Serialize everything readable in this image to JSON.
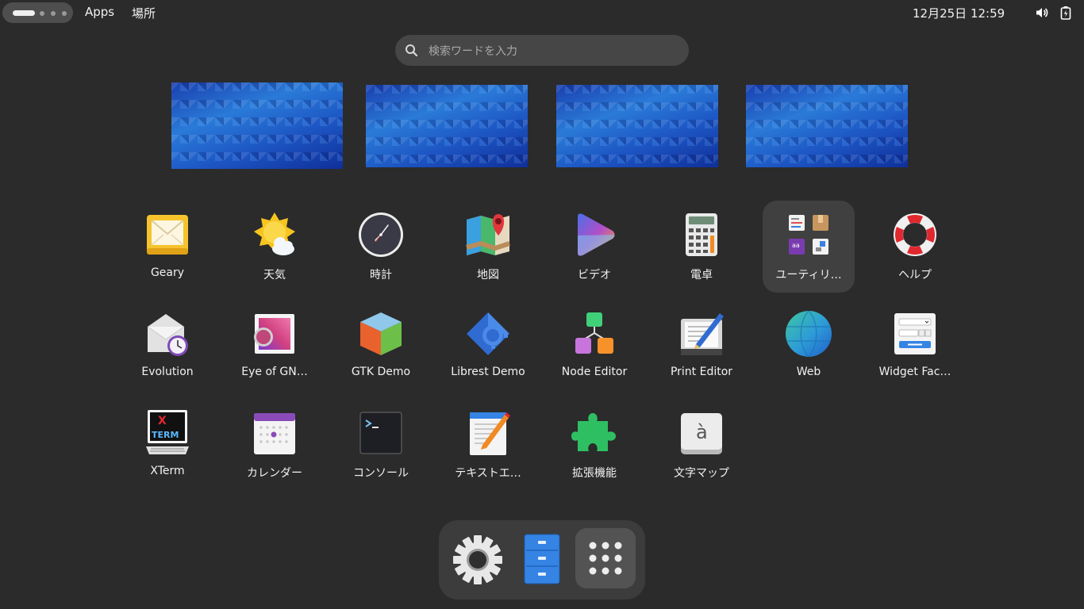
{
  "topbar": {
    "apps_label": "Apps",
    "places_label": "場所",
    "clock": "12月25日  12:59",
    "icons": [
      "volume-icon",
      "battery-icon"
    ]
  },
  "search": {
    "placeholder": "検索ワードを入力"
  },
  "workspaces": {
    "count": 4
  },
  "apps": [
    {
      "label": "Geary",
      "icon": "geary-icon"
    },
    {
      "label": "天気",
      "icon": "weather-icon"
    },
    {
      "label": "時計",
      "icon": "clock-icon"
    },
    {
      "label": "地図",
      "icon": "maps-icon"
    },
    {
      "label": "ビデオ",
      "icon": "video-icon"
    },
    {
      "label": "電卓",
      "icon": "calculator-icon"
    },
    {
      "label": "ユーティリ…",
      "icon": "utilities-folder-icon"
    },
    {
      "label": "ヘルプ",
      "icon": "help-icon"
    },
    {
      "label": "Evolution",
      "icon": "evolution-icon"
    },
    {
      "label": "Eye of GN…",
      "icon": "image-viewer-icon"
    },
    {
      "label": "GTK Demo",
      "icon": "gtk-demo-icon"
    },
    {
      "label": "Librest Demo",
      "icon": "librest-demo-icon"
    },
    {
      "label": "Node Editor",
      "icon": "node-editor-icon"
    },
    {
      "label": "Print Editor",
      "icon": "print-editor-icon"
    },
    {
      "label": "Web",
      "icon": "web-icon"
    },
    {
      "label": "Widget Fac…",
      "icon": "widget-factory-icon"
    },
    {
      "label": "XTerm",
      "icon": "xterm-icon"
    },
    {
      "label": "カレンダー",
      "icon": "calendar-icon"
    },
    {
      "label": "コンソール",
      "icon": "console-icon"
    },
    {
      "label": "テキストエ…",
      "icon": "text-editor-icon"
    },
    {
      "label": "拡張機能",
      "icon": "extensions-icon"
    },
    {
      "label": "文字マップ",
      "icon": "character-map-icon"
    }
  ],
  "dock": [
    {
      "name": "settings",
      "icon": "gear-icon"
    },
    {
      "name": "files",
      "icon": "file-cabinet-icon"
    },
    {
      "name": "show-apps",
      "icon": "app-grid-icon"
    }
  ],
  "xterm_text": [
    "X",
    "TERM"
  ],
  "char_map_glyph": "à",
  "colors": {
    "background": "#2b2b2b",
    "search": "#464646",
    "dock": "#3c3c3c"
  }
}
